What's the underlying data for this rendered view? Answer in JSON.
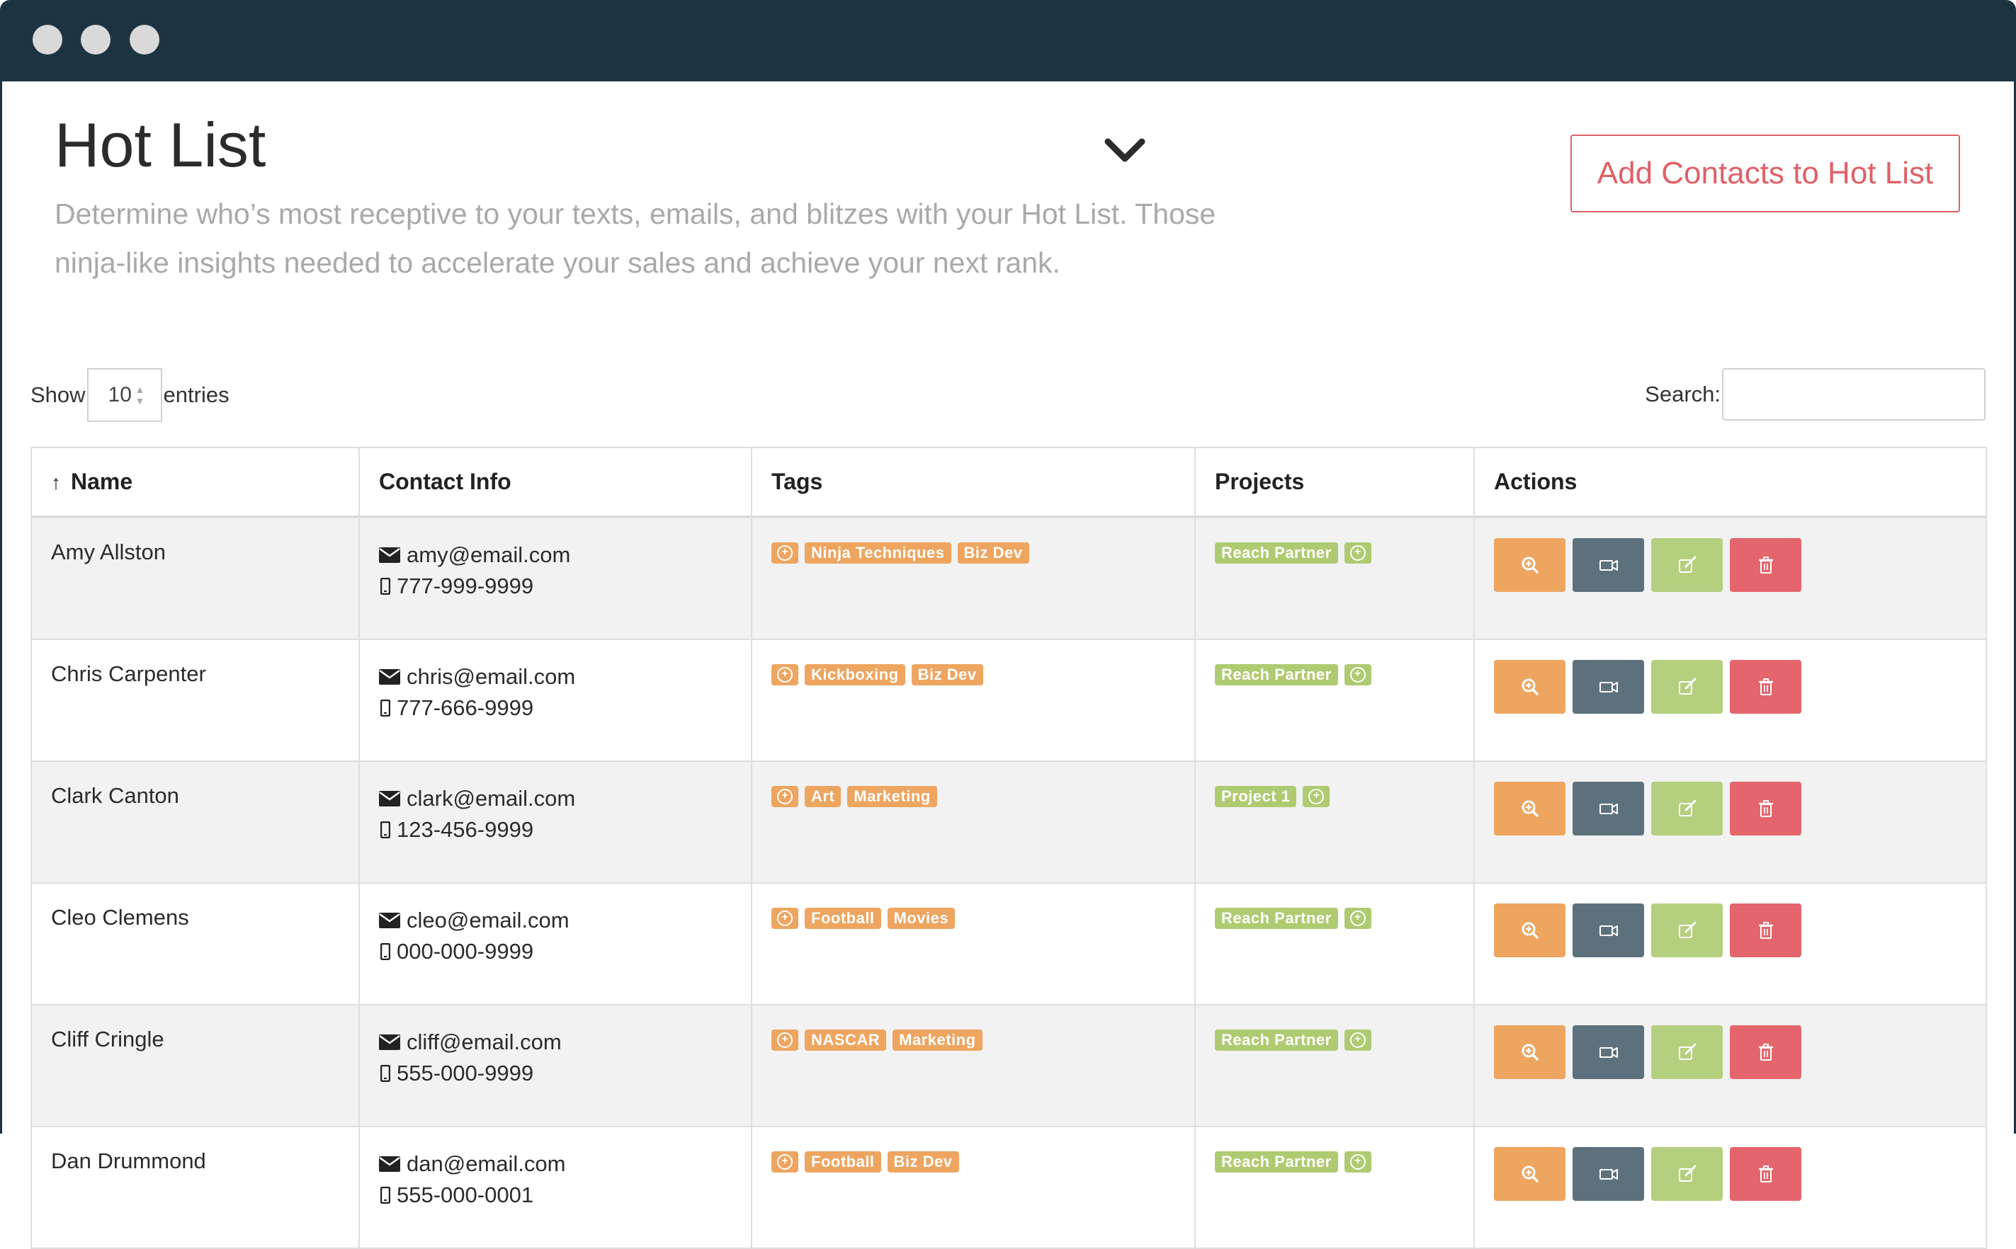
{
  "header": {
    "title": "Hot List",
    "subtitle": "Determine who’s most receptive to your texts, emails, and blitzes with your Hot List. Those ninja-like insights needed to accelerate your sales and achieve your next rank.",
    "add_button": "Add Contacts to Hot List"
  },
  "length_menu": {
    "show": "Show",
    "value": "10",
    "entries": "entries"
  },
  "search": {
    "label": "Search:",
    "value": ""
  },
  "table": {
    "columns": [
      "Name",
      "Contact Info",
      "Tags",
      "Projects",
      "Actions"
    ],
    "sort_indicator": "↑"
  },
  "rows": [
    {
      "name": "Amy Allston",
      "email": "amy@email.com",
      "phone": "777-999-9999",
      "tags": [
        "Ninja Techniques",
        "Biz Dev"
      ],
      "project": "Reach Partner"
    },
    {
      "name": "Chris Carpenter",
      "email": "chris@email.com",
      "phone": "777-666-9999",
      "tags": [
        "Kickboxing",
        "Biz Dev"
      ],
      "project": "Reach Partner"
    },
    {
      "name": "Clark Canton",
      "email": "clark@email.com",
      "phone": "123-456-9999",
      "tags": [
        "Art",
        "Marketing"
      ],
      "project": "Project 1"
    },
    {
      "name": "Cleo Clemens",
      "email": "cleo@email.com",
      "phone": "000-000-9999",
      "tags": [
        "Football",
        "Movies"
      ],
      "project": "Reach Partner"
    },
    {
      "name": "Cliff Cringle",
      "email": "cliff@email.com",
      "phone": "555-000-9999",
      "tags": [
        "NASCAR",
        "Marketing"
      ],
      "project": "Reach Partner"
    },
    {
      "name": "Dan Drummond",
      "email": "dan@email.com",
      "phone": "555-000-0001",
      "tags": [
        "Football",
        "Biz Dev"
      ],
      "project": "Reach Partner"
    }
  ],
  "icons": {
    "window_controls": [
      "window-dot-icon",
      "window-dot-icon",
      "window-dot-icon"
    ],
    "header": "chevron-down-icon",
    "contact": [
      "mail-icon",
      "mobile-phone-icon"
    ],
    "badge_add": "plus-circle-icon",
    "actions": [
      "zoom-in-icon",
      "video-camera-icon",
      "edit-icon",
      "trash-icon"
    ]
  },
  "colors": {
    "titlebar": "#1c3442",
    "accent_red": "#e06067",
    "tag_orange": "#eda560",
    "tag_green": "#aecb71",
    "btn_view": "#eda560",
    "btn_video": "#5d717c",
    "btn_edit": "#b4cf7e",
    "btn_delete": "#e4666c"
  }
}
